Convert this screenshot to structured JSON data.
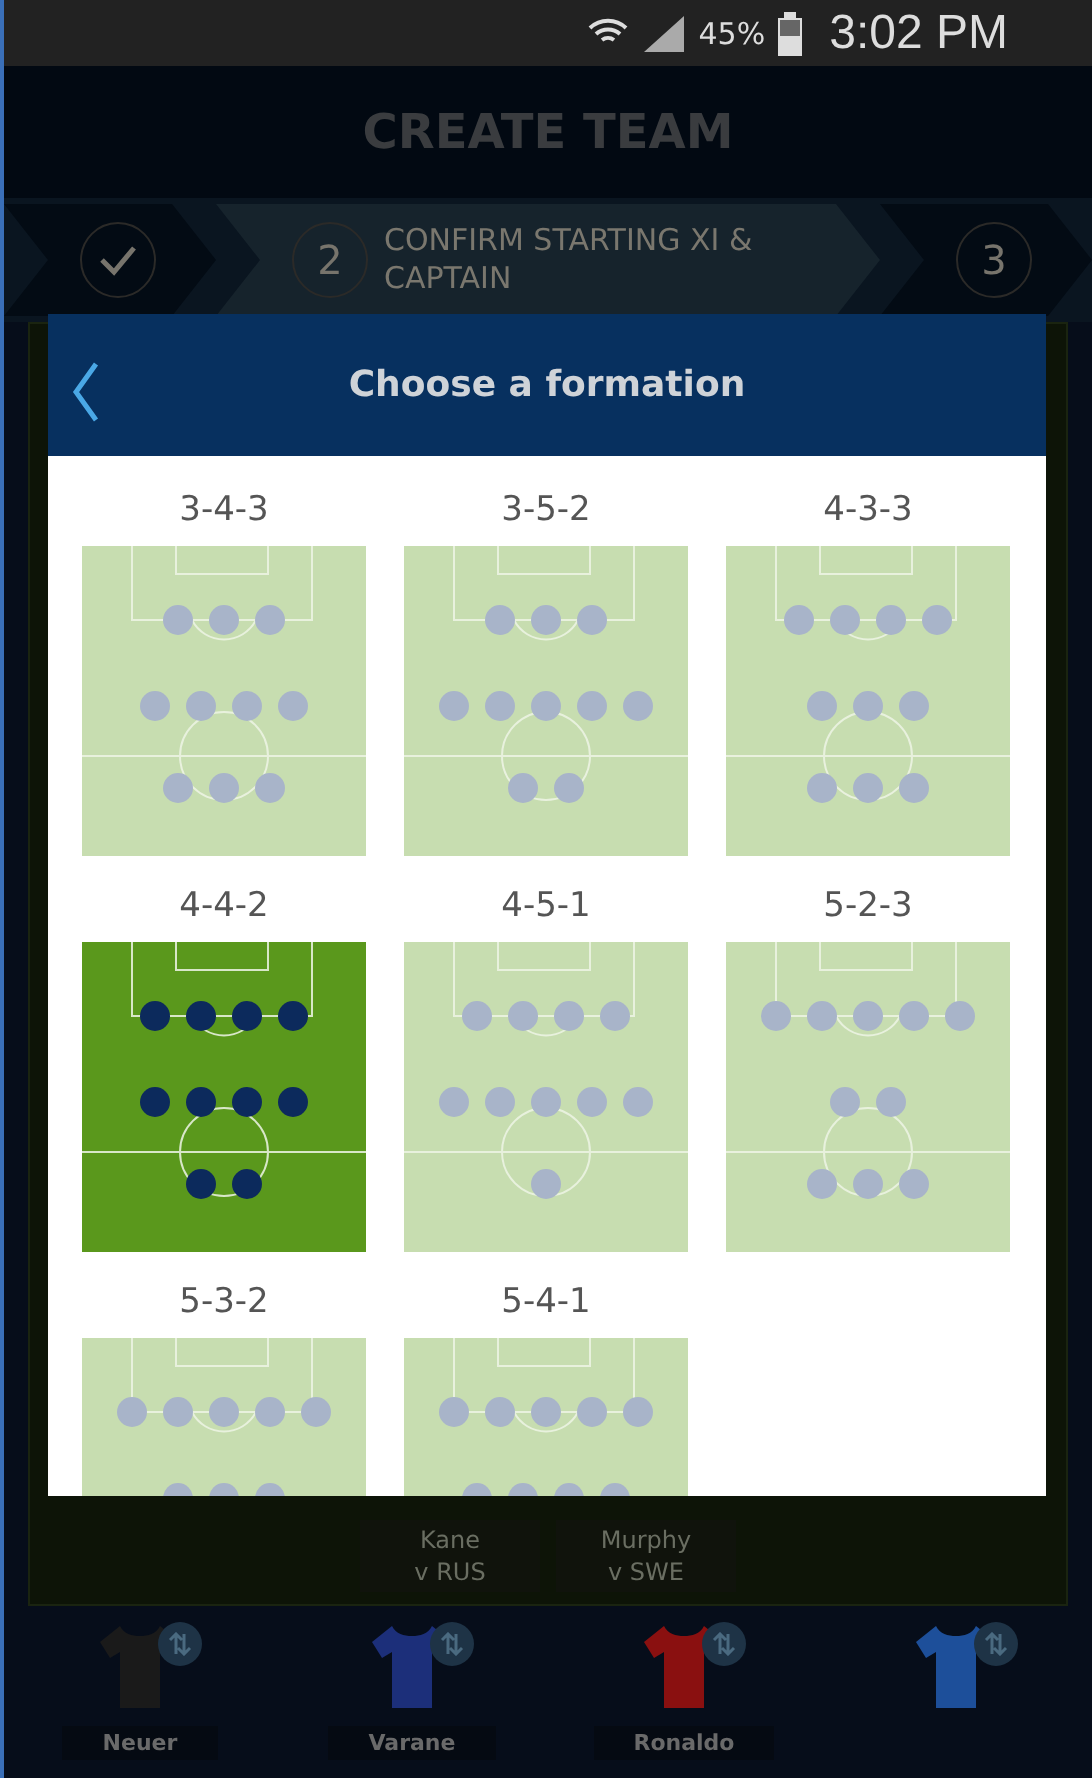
{
  "status_bar": {
    "battery": "45%",
    "time": "3:02 PM"
  },
  "header": {
    "title": "CREATE TEAM"
  },
  "steps": [
    {
      "kind": "done",
      "selected": false
    },
    {
      "kind": "current",
      "number": "2",
      "label": "CONFIRM STARTING XI & CAPTAIN",
      "selected": true
    },
    {
      "kind": "todo",
      "number": "3",
      "selected": false
    }
  ],
  "dialog": {
    "title": "Choose a formation",
    "formations": [
      {
        "label": "3-4-3",
        "selected": false
      },
      {
        "label": "3-5-2",
        "selected": false
      },
      {
        "label": "4-3-3",
        "selected": false
      },
      {
        "label": "4-4-2",
        "selected": true
      },
      {
        "label": "4-5-1",
        "selected": false
      },
      {
        "label": "5-2-3",
        "selected": false
      },
      {
        "label": "5-3-2",
        "selected": false
      },
      {
        "label": "5-4-1",
        "selected": false
      }
    ]
  },
  "fixtures": [
    {
      "player": "Kane",
      "opponent": "v RUS"
    },
    {
      "player": "Murphy",
      "opponent": "v SWE"
    }
  ],
  "squad": [
    {
      "name": "Neuer",
      "color": "#1a1a1a"
    },
    {
      "name": "Varane",
      "color": "#1c2f7a"
    },
    {
      "name": "Ronaldo",
      "color": "#8a1010"
    },
    {
      "color": "#1d4f9a"
    }
  ]
}
